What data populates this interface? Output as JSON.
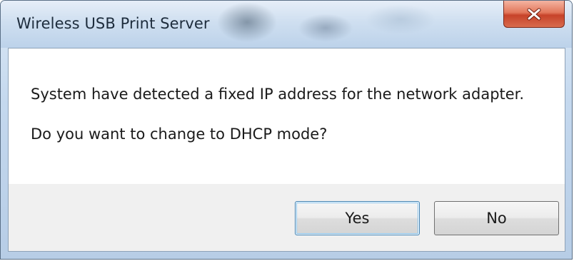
{
  "window": {
    "title": "Wireless USB Print Server",
    "close_icon": "close-icon"
  },
  "message": {
    "line1": "System have detected a fixed IP address for the network adapter.",
    "line2": "Do you want to change to DHCP mode?"
  },
  "buttons": {
    "yes_label": "Yes",
    "no_label": "No"
  },
  "colors": {
    "close_button": "#d9573c",
    "default_button_border": "#3c7fb1",
    "button_area_background": "#f0f0f0"
  }
}
